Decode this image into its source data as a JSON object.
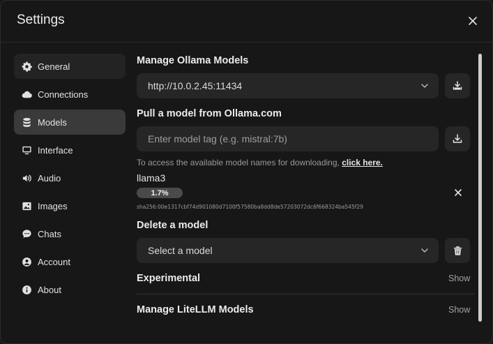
{
  "dialog": {
    "title": "Settings"
  },
  "sidebar": {
    "items": [
      {
        "label": "General",
        "icon": "gear-icon"
      },
      {
        "label": "Connections",
        "icon": "cloud-icon"
      },
      {
        "label": "Models",
        "icon": "database-icon"
      },
      {
        "label": "Interface",
        "icon": "monitor-icon"
      },
      {
        "label": "Audio",
        "icon": "speaker-icon"
      },
      {
        "label": "Images",
        "icon": "image-icon"
      },
      {
        "label": "Chats",
        "icon": "chat-icon"
      },
      {
        "label": "Account",
        "icon": "user-icon"
      },
      {
        "label": "About",
        "icon": "info-icon"
      }
    ],
    "active": "Models"
  },
  "manage_ollama": {
    "heading": "Manage Ollama Models",
    "selected_url": "http://10.0.2.45:11434"
  },
  "pull": {
    "heading": "Pull a model from Ollama.com",
    "placeholder": "Enter model tag (e.g. mistral:7b)",
    "note": "To access the available model names for downloading,",
    "link": "click here."
  },
  "download": {
    "model": "llama3",
    "progress_label": "1.7%",
    "progress": 0.017,
    "digest": "sha256:00e1317cbf74d901080d7100f57580ba8dd8de57203072dc6f668324ba545f29"
  },
  "delete": {
    "heading": "Delete a model",
    "placeholder": "Select a model"
  },
  "experimental": {
    "label": "Experimental",
    "toggle": "Show"
  },
  "litellm": {
    "label": "Manage LiteLLM Models",
    "toggle": "Show"
  }
}
